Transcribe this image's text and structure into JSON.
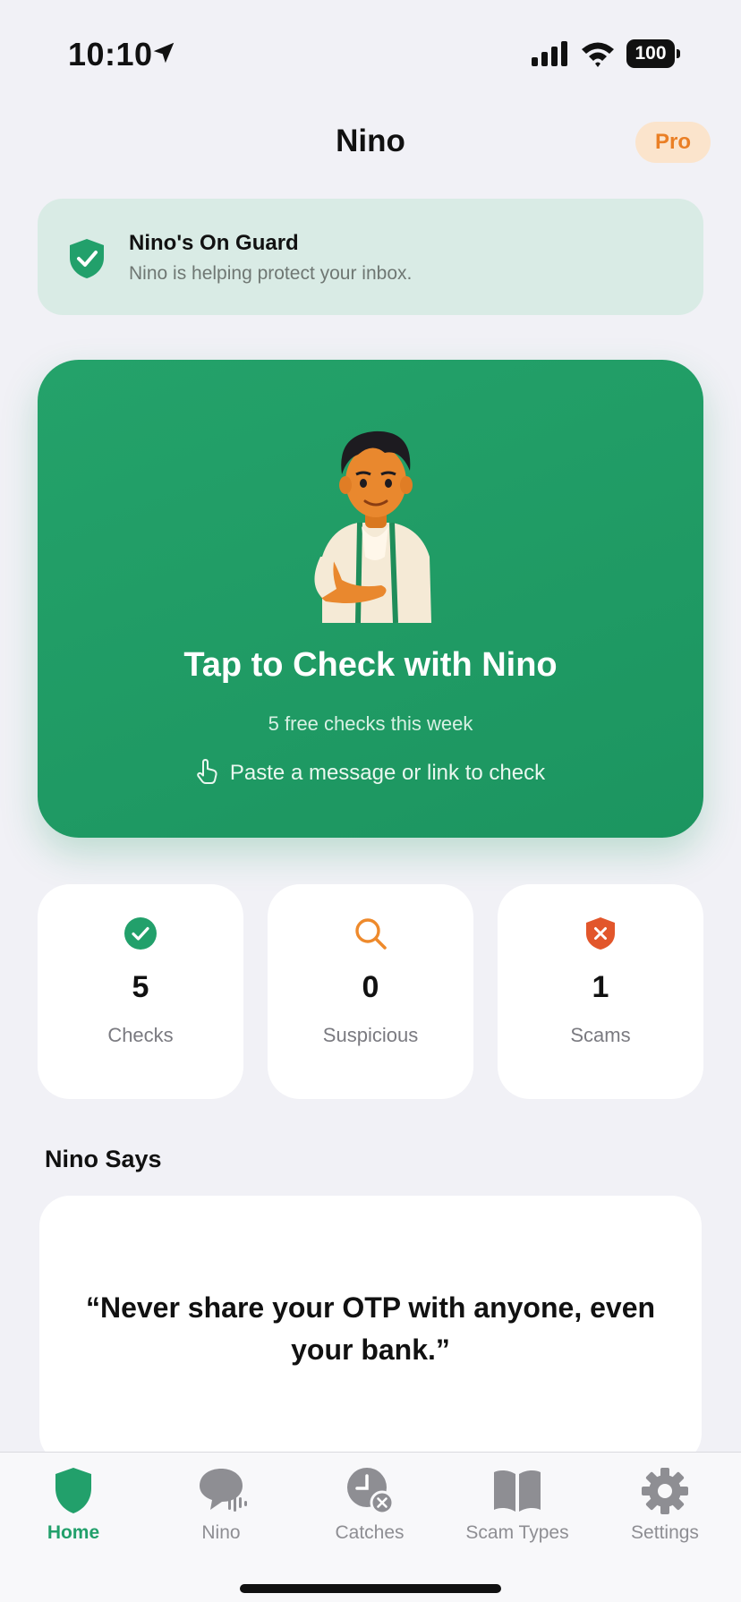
{
  "status_bar": {
    "time": "10:10",
    "battery": "100"
  },
  "nav": {
    "title": "Nino",
    "pro_label": "Pro"
  },
  "guard": {
    "title": "Nino's On Guard",
    "subtitle": "Nino is helping protect your inbox."
  },
  "hero": {
    "title": "Tap to Check with Nino",
    "subtitle": "5 free checks this week",
    "hint": "Paste a message or link to check"
  },
  "stats": [
    {
      "value": "5",
      "label": "Checks",
      "icon": "check-circle-icon",
      "color": "#22a06b"
    },
    {
      "value": "0",
      "label": "Suspicious",
      "icon": "magnifier-icon",
      "color": "#ee8a2c"
    },
    {
      "value": "1",
      "label": "Scams",
      "icon": "shield-x-icon",
      "color": "#e2562b"
    }
  ],
  "nino_says": {
    "title": "Nino Says",
    "quote": "“Never share your OTP with anyone, even your bank.”"
  },
  "tabs": [
    {
      "label": "Home",
      "icon": "shield-icon",
      "active": true
    },
    {
      "label": "Nino",
      "icon": "chat-voice-icon",
      "active": false
    },
    {
      "label": "Catches",
      "icon": "clock-x-icon",
      "active": false
    },
    {
      "label": "Scam Types",
      "icon": "book-icon",
      "active": false
    },
    {
      "label": "Settings",
      "icon": "gear-icon",
      "active": false
    }
  ],
  "colors": {
    "accent": "#22a06b",
    "pro": "#ea7f25",
    "scam": "#e2562b",
    "suspicious": "#ee8a2c",
    "background": "#f1f1f6"
  }
}
